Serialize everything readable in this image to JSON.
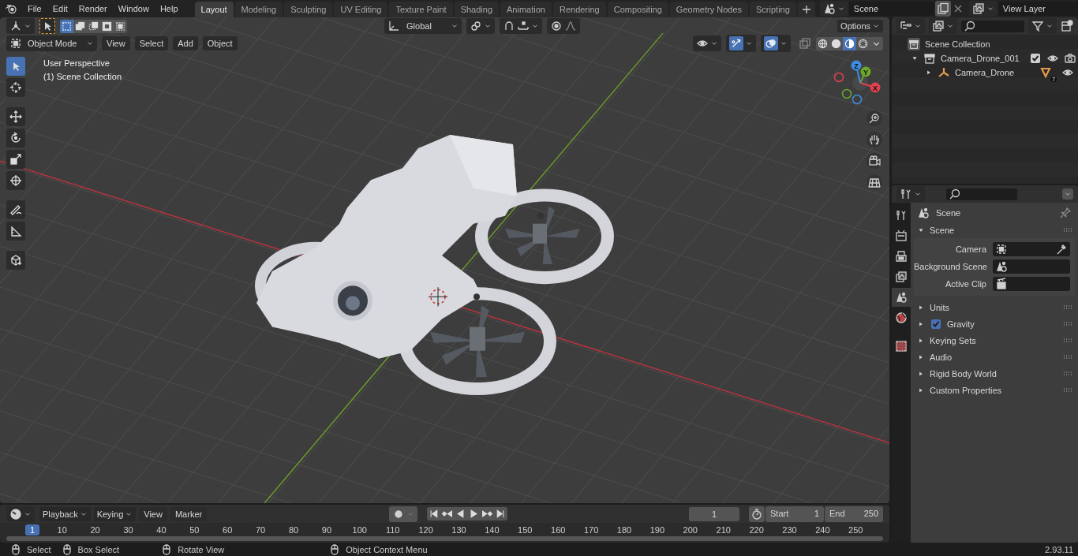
{
  "topbar": {
    "menus": [
      "File",
      "Edit",
      "Render",
      "Window",
      "Help"
    ],
    "workspaces": [
      {
        "label": "Layout",
        "selected": true
      },
      {
        "label": "Modeling",
        "selected": false
      },
      {
        "label": "Sculpting",
        "selected": false
      },
      {
        "label": "UV Editing",
        "selected": false
      },
      {
        "label": "Texture Paint",
        "selected": false
      },
      {
        "label": "Shading",
        "selected": false
      },
      {
        "label": "Animation",
        "selected": false
      },
      {
        "label": "Rendering",
        "selected": false
      },
      {
        "label": "Compositing",
        "selected": false
      },
      {
        "label": "Geometry Nodes",
        "selected": false
      },
      {
        "label": "Scripting",
        "selected": false
      }
    ],
    "scene": "Scene",
    "view_layer": "View Layer"
  },
  "viewport": {
    "select_modes": [
      {
        "selected": true
      },
      {
        "selected": false
      },
      {
        "selected": false
      },
      {
        "selected": false
      },
      {
        "selected": false
      }
    ],
    "transform_orientation": "Global",
    "options": "Options",
    "mode": "Object Mode",
    "menus": [
      "View",
      "Select",
      "Add",
      "Object"
    ],
    "show_gizmos": true,
    "show_overlays": true,
    "shading_modes": [
      {
        "selected": false
      },
      {
        "selected": false
      },
      {
        "selected": true
      },
      {
        "selected": false
      }
    ],
    "overlay_info": [
      "User Perspective",
      "(1) Scene Collection"
    ],
    "tools": [
      {
        "selected": true
      },
      {
        "selected": false
      },
      {
        "selected": false
      },
      {
        "selected": false
      },
      {
        "selected": false
      },
      {
        "selected": false
      },
      {
        "selected": false
      },
      {
        "selected": false
      },
      {
        "selected": false
      }
    ],
    "gizmo_axes": [
      "X",
      "Y",
      "Z"
    ]
  },
  "outliner": {
    "root": "Scene Collection",
    "items": [
      {
        "label": "Camera_Drone_001",
        "expanded": true,
        "checked": true,
        "children": [
          {
            "label": "Camera_Drone",
            "expanded": false,
            "badge": "7"
          }
        ]
      }
    ]
  },
  "properties": {
    "tabs": [
      {
        "selected": false
      },
      {
        "selected": false
      },
      {
        "selected": false
      },
      {
        "selected": false
      },
      {
        "selected": true
      },
      {
        "selected": false
      },
      {
        "selected": false
      }
    ],
    "title": "Scene",
    "panels": [
      {
        "label": "Scene",
        "kind": "plain",
        "expanded": true,
        "fields": [
          {
            "label": "Camera"
          },
          {
            "label": "Background Scene"
          },
          {
            "label": "Active Clip"
          }
        ]
      },
      {
        "label": "Units",
        "kind": "plain",
        "expanded": false
      },
      {
        "label": "Gravity",
        "kind": "checkbox",
        "expanded": false,
        "checked": true
      },
      {
        "label": "Keying Sets",
        "kind": "plain",
        "expanded": false
      },
      {
        "label": "Audio",
        "kind": "plain",
        "expanded": false
      },
      {
        "label": "Rigid Body World",
        "kind": "plain",
        "expanded": false
      },
      {
        "label": "Custom Properties",
        "kind": "plain",
        "expanded": false
      }
    ]
  },
  "timeline": {
    "menus": [
      {
        "label": "Playback",
        "kind": "dropdown"
      },
      {
        "label": "Keying",
        "kind": "dropdown"
      },
      {
        "label": "View",
        "kind": "menu"
      },
      {
        "label": "Marker",
        "kind": "menu"
      }
    ],
    "current_frame": "1",
    "start_label": "Start",
    "start": "1",
    "end_label": "End",
    "end": "250",
    "playhead": "1",
    "ticks": [
      "10",
      "20",
      "30",
      "40",
      "50",
      "60",
      "70",
      "80",
      "90",
      "100",
      "110",
      "120",
      "130",
      "140",
      "150",
      "160",
      "170",
      "180",
      "190",
      "200",
      "210",
      "220",
      "230",
      "240",
      "250"
    ]
  },
  "status_bar": {
    "hints": [
      "Select",
      "Box Select",
      "Rotate View",
      "Object Context Menu"
    ],
    "version": "2.93.11"
  }
}
